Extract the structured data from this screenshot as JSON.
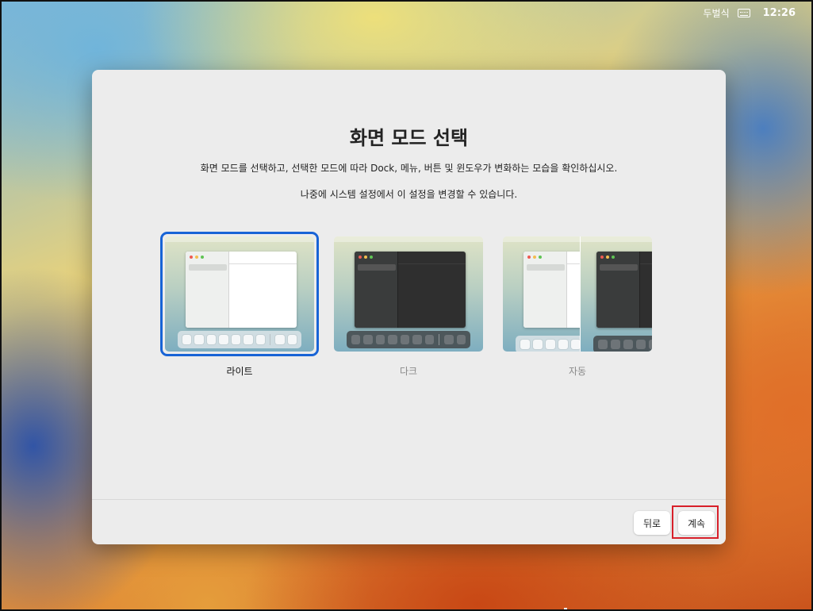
{
  "status_bar": {
    "input_method": "두벌식",
    "keyboard_icon": "keyboard-icon",
    "time": "12:26"
  },
  "dialog": {
    "title": "화면 모드 선택",
    "subtitle": "화면 모드를 선택하고, 선택한 모드에 따라 Dock, 메뉴, 버튼 및 윈도우가 변화하는 모습을 확인하십시오.",
    "note": "나중에 시스템 설정에서 이 설정을 변경할 수 있습니다.",
    "options": [
      {
        "id": "light",
        "label": "라이트",
        "selected": true
      },
      {
        "id": "dark",
        "label": "다크",
        "selected": false
      },
      {
        "id": "auto",
        "label": "자동",
        "selected": false
      }
    ],
    "buttons": {
      "back": "뒤로",
      "continue": "계속"
    }
  },
  "colors": {
    "selection": "#1864d6",
    "highlight": "#d8202a"
  }
}
